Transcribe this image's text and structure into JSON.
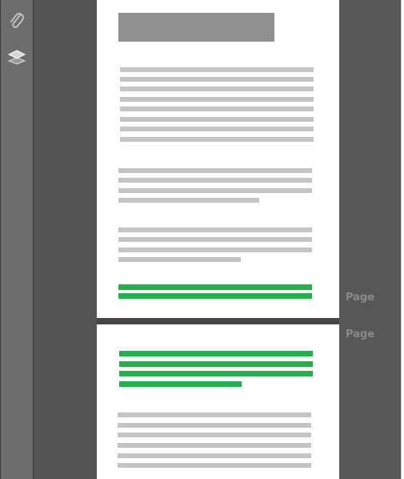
{
  "left_toolbar": {
    "icons": [
      "paperclip-icon",
      "layers-icon"
    ]
  },
  "thumbnails": {
    "page_1_label": "Page",
    "page_2_label": "Page"
  },
  "colors": {
    "background": "#575757",
    "rail": "#6d6d6d",
    "page": "#ffffff",
    "placeholder_text": "#c4c4c4",
    "highlight": "#22b14c",
    "title_block": "#8f8f8f"
  }
}
